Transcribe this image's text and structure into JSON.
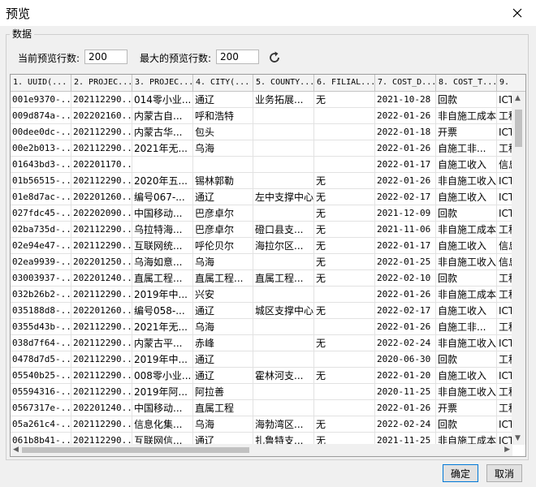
{
  "window": {
    "title": "预览"
  },
  "group": {
    "label": "数据"
  },
  "controls": {
    "current_rows_label": "当前预览行数:",
    "current_rows_value": "200",
    "max_rows_label": "最大的预览行数:",
    "max_rows_value": "200"
  },
  "table": {
    "columns": [
      "1. UUID(...",
      "2. PROJEC...",
      "3. PROJEC...",
      "4. CITY(...",
      "5. COUNTY...",
      "6. FILIAL...",
      "7. COST_D...",
      "8. COST_T...",
      "9."
    ],
    "rows": [
      [
        "001e9370-...",
        "202112290...",
        "014零小业...",
        "通辽",
        "业务拓展...",
        "无",
        "2021-10-28",
        "回款",
        "ICT"
      ],
      [
        "009d874a-...",
        "202202160...",
        "内蒙古自...",
        "呼和浩特",
        "",
        "",
        "2022-01-26",
        "非自施工成本",
        "工程"
      ],
      [
        "00dee0dc-...",
        "202112290...",
        "内蒙古华...",
        "包头",
        "",
        "",
        "2022-01-18",
        "开票",
        "ICT"
      ],
      [
        "00e2b013-...",
        "202112290...",
        "2021年无...",
        "乌海",
        "",
        "",
        "2022-01-26",
        "自施工非...",
        "工程"
      ],
      [
        "01643bd3-...",
        "202201170...",
        "",
        "",
        "",
        "",
        "2022-01-17",
        "自施工收入",
        "信息"
      ],
      [
        "01b56515-...",
        "202112290...",
        "2020年五...",
        "锡林郭勒",
        "",
        "无",
        "2022-01-26",
        "非自施工收入",
        "ICT"
      ],
      [
        "01e8d7ac-...",
        "202201260...",
        "编号067-...",
        "通辽",
        "左中支撑中心",
        "无",
        "2022-02-17",
        "自施工收入",
        "ICT"
      ],
      [
        "027fdc45-...",
        "202202090...",
        "中国移动...",
        "巴彦卓尔",
        "",
        "无",
        "2021-12-09",
        "回款",
        "ICT"
      ],
      [
        "02ba735d-...",
        "202112290...",
        "乌拉特海...",
        "巴彦卓尔",
        "磴口县支...",
        "无",
        "2021-11-06",
        "非自施工成本",
        "工程"
      ],
      [
        "02e94e47-...",
        "202112290...",
        "互联网统...",
        "呼伦贝尔",
        "海拉尔区...",
        "无",
        "2022-01-17",
        "自施工收入",
        "信息"
      ],
      [
        "02ea9939-...",
        "202201250...",
        "乌海如意...",
        "乌海",
        "",
        "无",
        "2022-01-25",
        "非自施工收入",
        "信息"
      ],
      [
        "03003937-...",
        "202201240...",
        "直属工程...",
        "直属工程...",
        "直属工程...",
        "无",
        "2022-02-10",
        "回款",
        "工程"
      ],
      [
        "032b26b2-...",
        "202112290...",
        "2019年中...",
        "兴安",
        "",
        "",
        "2022-01-26",
        "非自施工成本",
        "工程"
      ],
      [
        "035188d8-...",
        "202201260...",
        "编号058-...",
        "通辽",
        "城区支撑中心",
        "无",
        "2022-02-17",
        "自施工收入",
        "ICT"
      ],
      [
        "0355d43b-...",
        "202112290...",
        "2021年无...",
        "乌海",
        "",
        "",
        "2022-01-26",
        "自施工非...",
        "工程"
      ],
      [
        "038d7f64-...",
        "202112290...",
        "内蒙古平...",
        "赤峰",
        "",
        "无",
        "2022-02-24",
        "非自施工收入",
        "ICT"
      ],
      [
        "0478d7d5-...",
        "202112290...",
        "2019年中...",
        "通辽",
        "",
        "",
        "2020-06-30",
        "回款",
        "工程"
      ],
      [
        "05540b25-...",
        "202112290...",
        "008零小业...",
        "通辽",
        "霍林河支...",
        "无",
        "2022-01-20",
        "自施工收入",
        "ICT"
      ],
      [
        "05594316-...",
        "202112290...",
        "2019年阿...",
        "阿拉善",
        "",
        "",
        "2020-11-25",
        "非自施工收入",
        "工程"
      ],
      [
        "0567317e-...",
        "202201240...",
        "中国移动...",
        "直属工程",
        "",
        "",
        "2022-01-26",
        "开票",
        "工程"
      ],
      [
        "05a261c4-...",
        "202112290...",
        "信息化集...",
        "乌海",
        "海勃湾区...",
        "无",
        "2022-02-24",
        "回款",
        "ICT"
      ],
      [
        "061b8b41-...",
        "202112290...",
        "互联网信...",
        "通辽",
        "扎鲁特支...",
        "无",
        "2021-11-25",
        "非自施工成本",
        "ICT"
      ]
    ]
  },
  "buttons": {
    "ok": "确定",
    "cancel": "取消"
  },
  "colors": {
    "accent": "#0078d7"
  }
}
